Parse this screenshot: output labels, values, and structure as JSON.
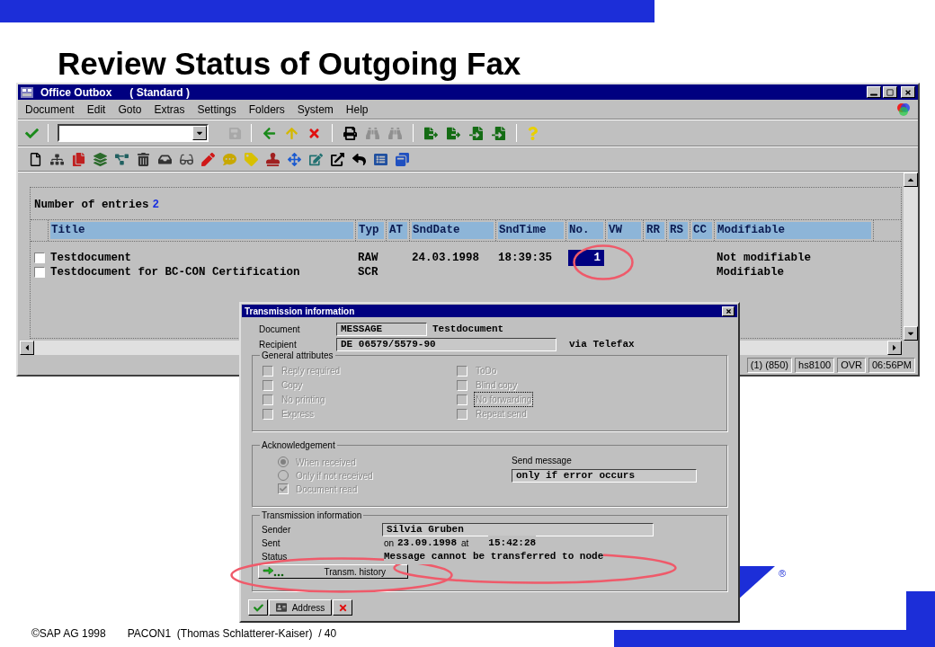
{
  "slide": {
    "title": "Review Status of Outgoing Fax",
    "registered_mark": "®",
    "footer": [
      "©SAP AG 1998",
      "PACON1  (Thomas Schlatterer-Kaiser)  / 40"
    ]
  },
  "window": {
    "title": "Office Outbox",
    "subtitle": "( Standard )",
    "menu": [
      "Document",
      "Edit",
      "Goto",
      "Extras",
      "Settings",
      "Folders",
      "System",
      "Help"
    ],
    "list": {
      "count_label": "Number of entries",
      "count": "2",
      "columns": [
        "Title",
        "Typ",
        "AT",
        "SndDate",
        "SndTime",
        "No.",
        "VW",
        "RR",
        "RS",
        "CC",
        "Modifiable"
      ],
      "rows": [
        {
          "checked": false,
          "cells": [
            "Testdocument",
            "RAW",
            null,
            "24.03.1998",
            "18:39:35",
            "1",
            null,
            null,
            null,
            null,
            "Not modifiable"
          ],
          "no_selected": true
        },
        {
          "checked": false,
          "cells": [
            "Testdocument for BC-CON Certification",
            "SCR",
            null,
            null,
            null,
            null,
            null,
            null,
            null,
            null,
            "Modifiable"
          ]
        }
      ]
    },
    "status_bar": [
      "(1) (850)",
      "hs8100",
      "OVR",
      "06:56PM"
    ]
  },
  "dialog": {
    "title": "Transmission information",
    "document": {
      "label": "Document",
      "value": "MESSAGE",
      "name": "Testdocument"
    },
    "recipient": {
      "label": "Recipient",
      "value": "DE 06579/5579-90",
      "via": "via Telefax"
    },
    "general": {
      "title": "General attributes",
      "options": [
        {
          "label": "Reply required",
          "checked": false,
          "disabled": true,
          "focused": false
        },
        {
          "label": "ToDo",
          "checked": false,
          "disabled": true,
          "focused": false
        },
        {
          "label": "Copy",
          "checked": false,
          "disabled": true,
          "focused": false
        },
        {
          "label": "Blind copy",
          "checked": false,
          "disabled": true,
          "focused": false
        },
        {
          "label": "No printing",
          "checked": false,
          "disabled": true,
          "focused": false
        },
        {
          "label": "No forwarding",
          "checked": false,
          "disabled": true,
          "focused": true
        },
        {
          "label": "Express",
          "checked": false,
          "disabled": true,
          "focused": false
        },
        {
          "label": "Repeat send",
          "checked": false,
          "disabled": true,
          "focused": false
        }
      ]
    },
    "acknowledgement": {
      "title": "Acknowledgement",
      "options": [
        {
          "kind": "radio",
          "label": "When received",
          "selected": true,
          "disabled": true
        },
        {
          "kind": "radio",
          "label": "Only if not received",
          "selected": false,
          "disabled": true
        },
        {
          "kind": "checkbox",
          "label": "Document read",
          "checked": true,
          "disabled": true
        }
      ],
      "send_message": {
        "label": "Send message",
        "value": "only if error occurs"
      }
    },
    "transmission": {
      "title": "Transmission information",
      "sender": {
        "label": "Sender",
        "value": "Silvia Gruben"
      },
      "sent": {
        "label": "Sent",
        "on": "on",
        "date": "23.09.1998",
        "at": "at",
        "time": "15:42:28"
      },
      "status": {
        "label": "Status",
        "value": "Message cannot be transferred to node"
      },
      "history_button": "Transm. history"
    },
    "buttons": [
      {
        "kind": "confirm"
      },
      {
        "kind": "address",
        "label": "Address"
      },
      {
        "kind": "cancel"
      }
    ]
  }
}
